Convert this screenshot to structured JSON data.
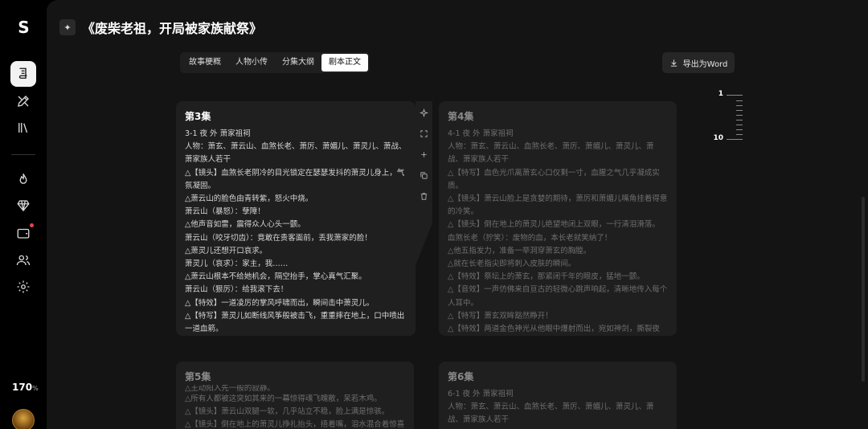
{
  "app": {
    "logo": "S",
    "credits": "170",
    "credits_unit": "%"
  },
  "header": {
    "title": "《废柴老祖，开局被家族献祭》",
    "title_icon": "sparkle-icon"
  },
  "tabs": [
    {
      "label": "故事梗概",
      "active": false
    },
    {
      "label": "人物小传",
      "active": false
    },
    {
      "label": "分集大纲",
      "active": false
    },
    {
      "label": "剧本正文",
      "active": true
    }
  ],
  "toolbar": {
    "export_label": "导出为Word"
  },
  "ruler": {
    "top_label": "1",
    "bottom_label": "10"
  },
  "cards": [
    {
      "title": "第3集",
      "lines": [
        "3-1 夜 外 萧家祖祠",
        "人物：萧玄、萧云山、血煞长老、萧厉、萧媚儿、萧灵儿、萧战、萧家族人若干",
        "△【镜头】血煞长老阴冷的目光锁定在瑟瑟发抖的萧灵儿身上，气氛凝固。",
        "△萧云山的脸色由青转紫，怒火中烧。",
        "萧云山（暴怒）：孽障！",
        "△他声音如雷，震得众人心头一颤。",
        "萧云山（咬牙切齿）：竟敢在贵客面前，丢我萧家的脸！",
        "△萧灵儿还想开口哀求。",
        "萧灵儿（哀求）：家主，我……",
        "△萧云山根本不给她机会，隔空抬手，掌心真气汇聚。",
        "萧云山（狠厉）：给我滚下去！",
        "△【特效】一道凌厉的掌风呼啸而出，瞬间击中萧灵儿。",
        "△【特写】萧灵儿如断线风筝般被击飞，重重摔在地上，口中喷出一道血箭。"
      ]
    },
    {
      "title": "第4集",
      "lines": [
        "4-1 夜 外 萧家祖祠",
        "人物：萧玄、萧云山、血煞长老、萧厉、萧媚儿、萧灵儿、萧战、萧家族人若干",
        "△【特写】血色光爪离萧玄心口仅剩一寸，血腥之气几乎凝成实质。",
        "△【镜头】萧云山脸上是贪婪的期待，萧厉和萧媚儿嘴角挂着得意的冷笑。",
        "△【镜头】倒在地上的萧灵儿绝望地闭上双眼，一行清泪滑落。",
        "血煞长老（狞笑）：废物的血，本长老就笑纳了！",
        "△他五指发力，准备一举洞穿萧玄的胸膛。",
        "△就在长老指尖即将刺入皮肤的瞬间。",
        "△【特效】祭坛上的萧玄，那紧闭千年的眼皮，猛地一颤。",
        "△【音效】一声仿佛来自亘古的轻微心跳声响起，清晰地传入每个人耳中。",
        "△【特写】萧玄双眸豁然睁开！",
        "△【特效】两道金色神光从他眼中爆射而出，宛如神剑，撕裂夜"
      ]
    },
    {
      "title": "第5集",
      "lines": [
        "△王动阳入先一般的寂静。",
        "△所有人都被这突如其来的一幕惊得魂飞魄散，呆若木鸡。",
        "△【镜头】萧云山双腿一软，几乎站立不稳，脸上满是惊骇。",
        "△【镜头】倒在地上的萧灵儿挣扎抬头，捂着嘴，泪水混合着惊喜"
      ]
    },
    {
      "title": "第6集",
      "lines": [
        "6-1 夜 外 萧家祖祠",
        "人物：萧玄、萧云山、血煞长老、萧厉、萧媚儿、萧灵儿、萧战、萧家族人若干"
      ]
    }
  ]
}
